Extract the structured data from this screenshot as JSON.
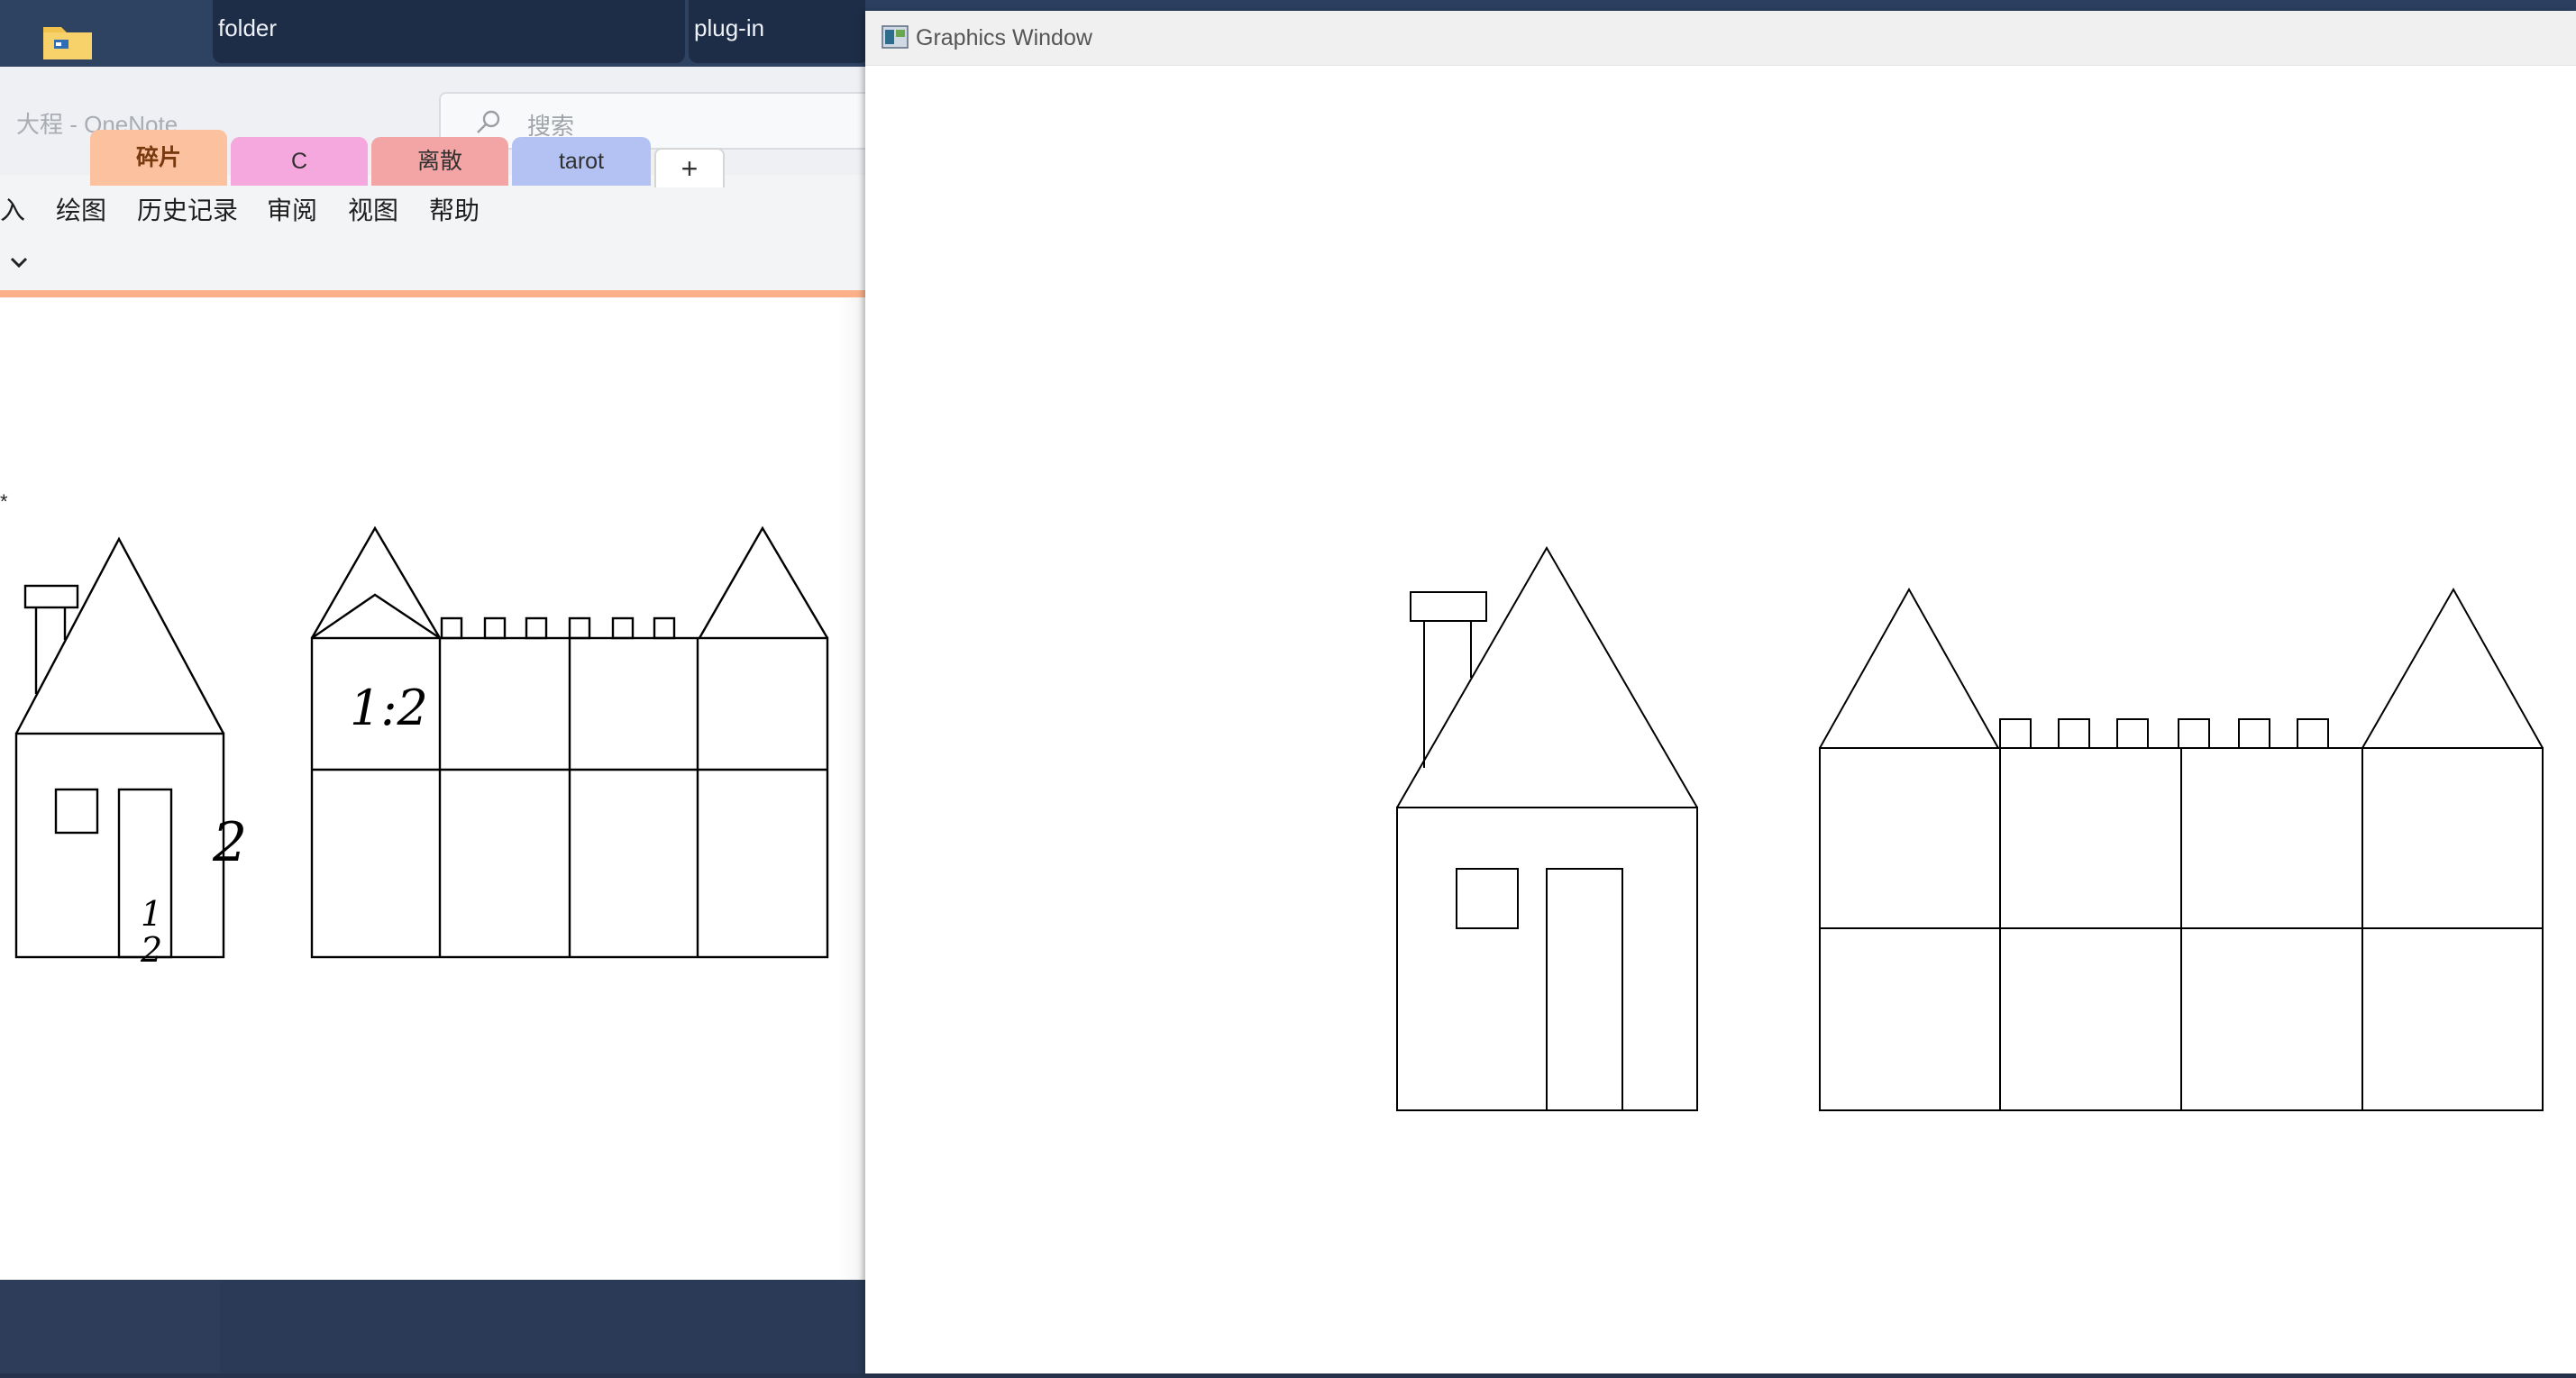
{
  "taskbar": {
    "thumbnails": [
      {
        "label": "folder"
      },
      {
        "label": "plug-in"
      }
    ]
  },
  "onenote": {
    "title": "大程  -  OneNote",
    "search": {
      "placeholder": "搜索"
    },
    "menu": [
      "入",
      "绘图",
      "历史记录",
      "审阅",
      "视图",
      "帮助"
    ],
    "tabs": [
      {
        "label": "碎片",
        "color": "#fcc19e"
      },
      {
        "label": "C",
        "color": "#f5a8dd"
      },
      {
        "label": "离散",
        "color": "#f3a5a5"
      },
      {
        "label": "tarot",
        "color": "#b3c2f2"
      }
    ],
    "add_tab": "+",
    "bullet": "*",
    "annotations": {
      "door_ratio_numerator": "1",
      "door_ratio_denominator": "2",
      "house_side": "2",
      "castle_ratio": "1:2"
    }
  },
  "graphics_window": {
    "title": "Graphics Window"
  },
  "colors": {
    "accent_tab_underline": "#fbb089",
    "desktop": "#2b3b58"
  }
}
